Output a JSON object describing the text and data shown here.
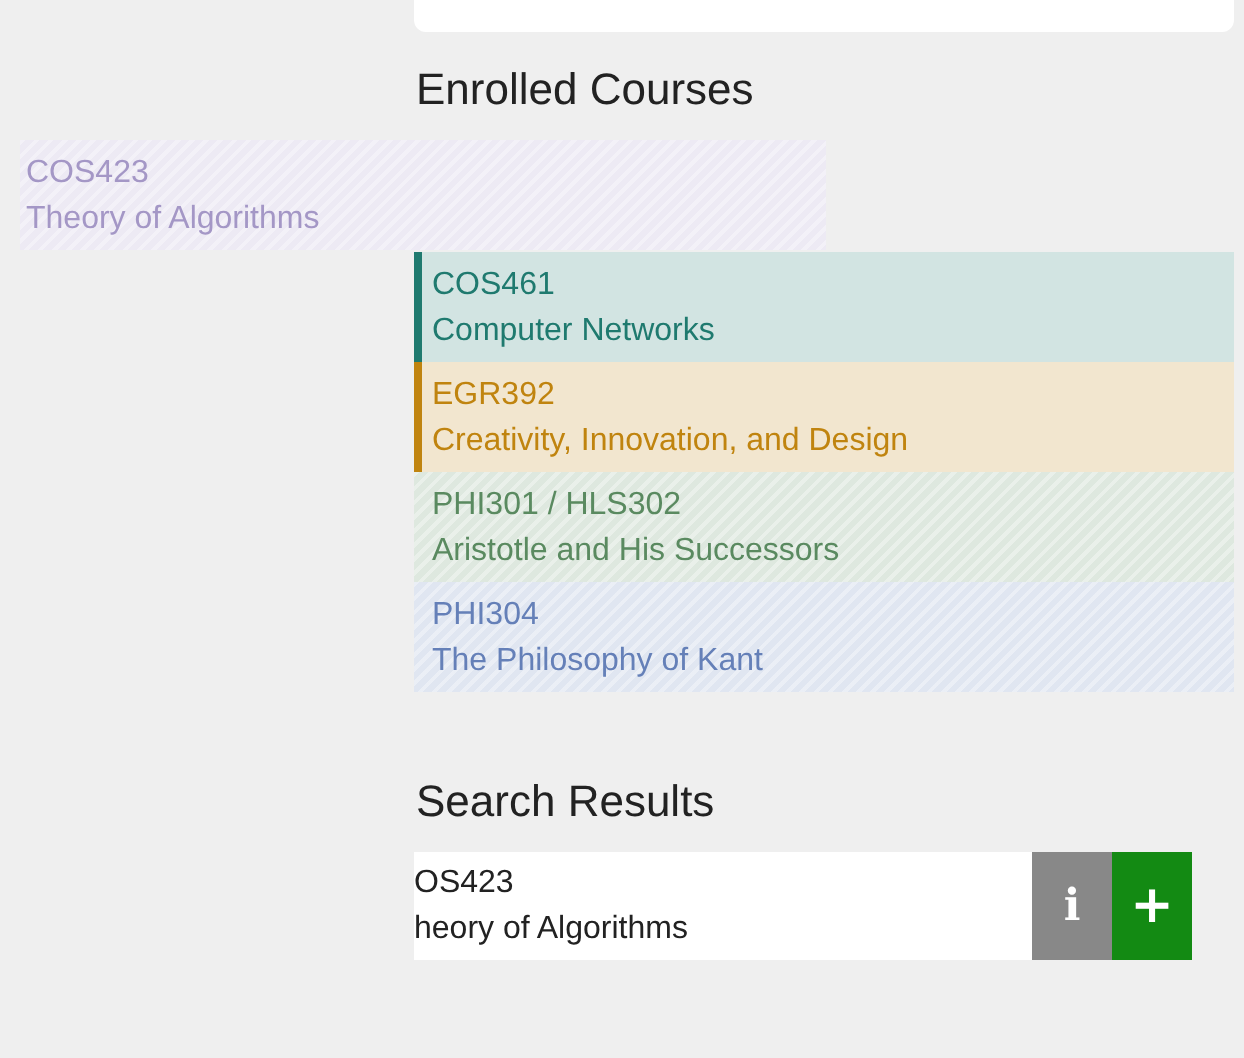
{
  "dragged_course": {
    "code": "COS423",
    "title": "Theory of Algorithms",
    "color": "#a497c6",
    "hatched": true
  },
  "enrolled": {
    "heading": "Enrolled Courses",
    "courses": [
      {
        "code": "COS461",
        "title": "Computer Networks",
        "color": "#1f7a6f",
        "hatched": false
      },
      {
        "code": "EGR392",
        "title": "Creativity, Innovation, and Design",
        "color": "#c0840f",
        "hatched": false
      },
      {
        "code": "PHI301 / HLS302",
        "title": "Aristotle and His Successors",
        "color": "#5a8a60",
        "hatched": true
      },
      {
        "code": "PHI304",
        "title": "The Philosophy of Kant",
        "color": "#6580b8",
        "hatched": true
      }
    ]
  },
  "search": {
    "heading": "Search Results",
    "results": [
      {
        "code": "OS423",
        "title": "heory of Algorithms",
        "info": "i",
        "add": "+"
      }
    ]
  }
}
